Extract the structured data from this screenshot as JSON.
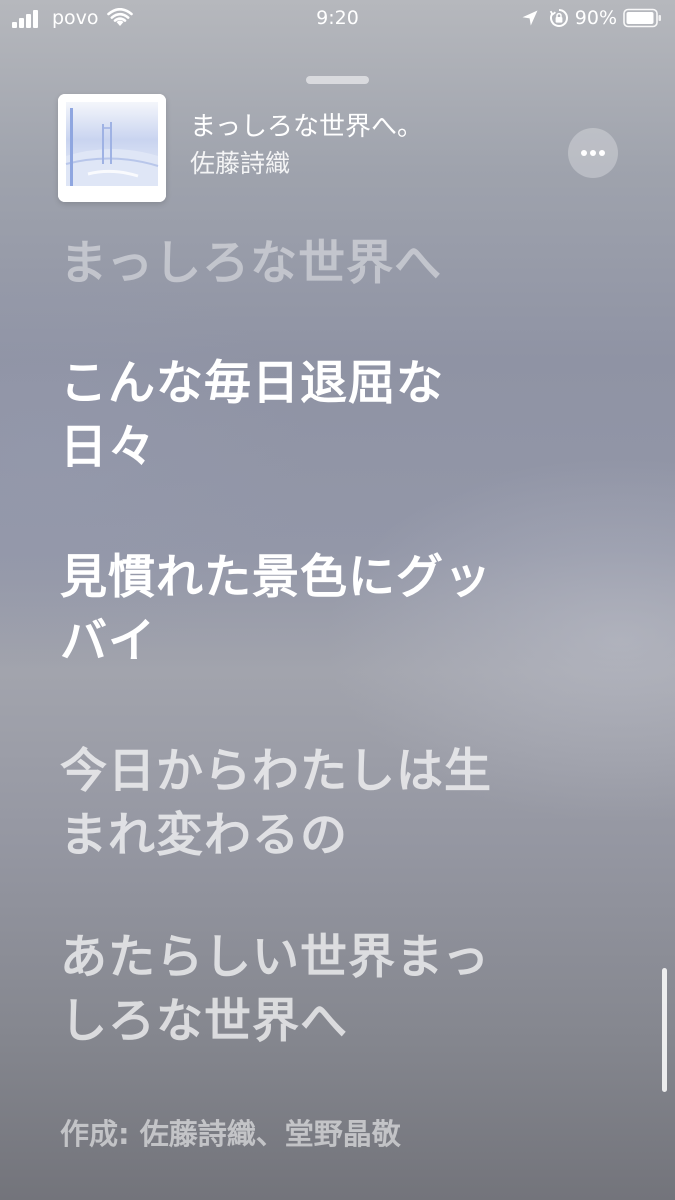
{
  "status_bar": {
    "carrier": "povo",
    "time": "9:20",
    "battery_percent": "90%",
    "battery_level": 0.9,
    "signal_bars": 4,
    "icons": [
      "signal-icon",
      "wifi-icon",
      "location-arrow-icon",
      "orientation-lock-icon",
      "battery-icon"
    ]
  },
  "now_playing": {
    "title": "まっしろな世界へ。",
    "artist": "佐藤詩織",
    "more_icon": "ellipsis-icon"
  },
  "lyrics": [
    {
      "lines": [
        "まっしろな世界へ"
      ],
      "state": "past"
    },
    {
      "lines": [
        "こんな毎日退屈な",
        "日々"
      ],
      "state": "active"
    },
    {
      "lines": [
        "見慣れた景色にグッ",
        "バイ"
      ],
      "state": "active"
    },
    {
      "lines": [
        "今日からわたしは生",
        "まれ変わるの"
      ],
      "state": "upcoming"
    },
    {
      "lines": [
        "あたらしい世界まっ",
        "しろな世界へ"
      ],
      "state": "upcoming"
    }
  ],
  "credits": "作成: 佐藤詩織、堂野晶敬",
  "colors": {
    "text": "#ffffff",
    "album_sky": "#c9d4f0"
  }
}
